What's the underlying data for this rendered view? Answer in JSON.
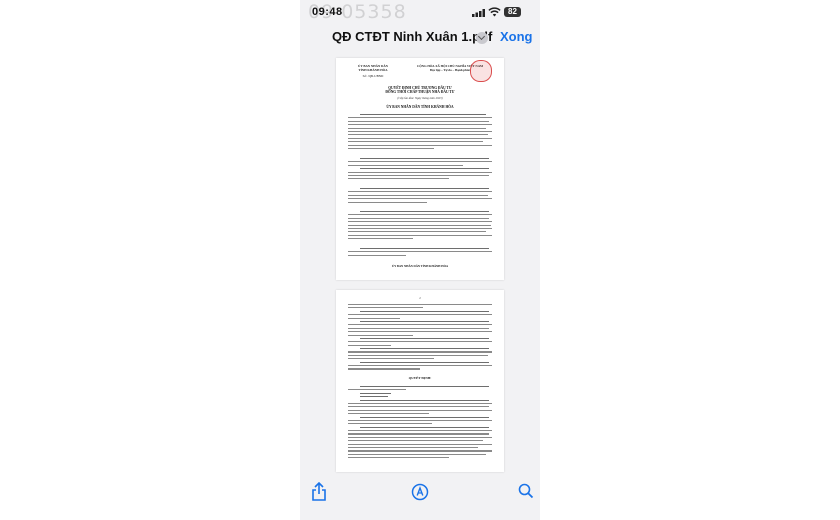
{
  "status_bar": {
    "time": "09:48",
    "watermark": "09  05358",
    "battery": "82",
    "signal_icon": "signal-icon",
    "wifi_icon": "wifi-icon"
  },
  "navbar": {
    "title": "QĐ CTĐT Ninh Xuân 1.pdf",
    "done_label": "Xong",
    "chevron_icon": "chevron-down-icon",
    "accent_color": "#1a73e8"
  },
  "document": {
    "page1": {
      "org_left": "ỦY BAN NHÂN DÂN\nTỈNH KHÁNH HÒA",
      "doc_number": "Số:       /QĐ-UBND",
      "org_right": "CỘNG HÒA XÃ HỘI CHỦ NGHĨA VIỆT NAM\nĐộc lập – Tự do – Hạnh phúc",
      "title": "QUYẾT ĐỊNH CHỦ TRƯƠNG ĐẦU TƯ\nĐỒNG THỜI CHẤP THUẬN NHÀ ĐẦU TƯ",
      "subtitle": "(Cấp lần đầu: Ngày    tháng   năm 2023)",
      "heading": "ỦY BAN NHÂN DÂN TỈNH KHÁNH HÒA"
    },
    "page2": {
      "page_number": "2",
      "decision_heading": "QUYẾT ĐỊNH:"
    }
  },
  "toolbar": {
    "share_icon": "share-icon",
    "markup_icon": "markup-icon",
    "search_icon": "search-icon"
  }
}
